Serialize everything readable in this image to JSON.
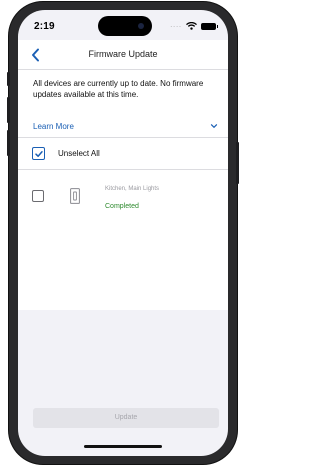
{
  "status_bar": {
    "time": "2:19",
    "signal": "....",
    "wifi_icon": "wifi-icon",
    "battery_icon": "battery-icon"
  },
  "navbar": {
    "back_icon": "chevron-left-icon",
    "title": "Firmware Update"
  },
  "main": {
    "message": "All devices are currently up to date. No firmware updates available at this time.",
    "learn_more": "Learn More",
    "select_all": {
      "label": "Unselect All",
      "checked": true
    },
    "devices": [
      {
        "name": "Kitchen, Main Lights",
        "status": "Completed",
        "checked": false,
        "icon": "light-switch-icon"
      }
    ]
  },
  "footer": {
    "update_label": "Update",
    "update_enabled": false
  },
  "colors": {
    "accent": "#1a5fb4",
    "success": "#2d8a2d",
    "disabled_button": "#e3e3e8"
  }
}
